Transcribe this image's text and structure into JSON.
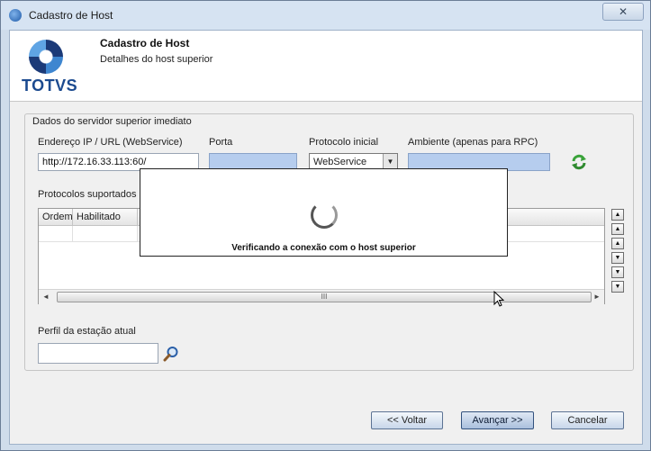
{
  "window": {
    "title": "Cadastro de Host",
    "close_label": "✕"
  },
  "header": {
    "logo_text": "TOTVS",
    "title": "Cadastro de Host",
    "subtitle": "Detalhes do host superior"
  },
  "group": {
    "legend": "Dados do servidor superior imediato",
    "address_label": "Endereço IP / URL (WebService)",
    "address_value": "http://172.16.33.113:60/",
    "port_label": "Porta",
    "port_value": "",
    "protocol_label": "Protocolo inicial",
    "protocol_value": "WebService",
    "environment_label": "Ambiente (apenas para RPC)",
    "environment_value": "",
    "refresh_icon": "refresh-icon"
  },
  "protocols": {
    "label": "Protocolos suportados",
    "columns": [
      "Ordem",
      "Habilitado"
    ],
    "scroll_glyph": "III",
    "scroll_left": "◄",
    "scroll_right": "►"
  },
  "side_buttons": [
    "▲",
    "▲",
    "▲",
    "▼",
    "▼",
    "▼"
  ],
  "profile": {
    "label": "Perfil da estação atual",
    "value": ""
  },
  "buttons": {
    "back": "<< Voltar",
    "next": "Avançar >>",
    "cancel": "Cancelar"
  },
  "overlay": {
    "message": "Verificando a conexão com o host superior"
  },
  "colors": {
    "accent": "#1b4a8f",
    "field_blue": "#b6cdee",
    "refresh_green": "#3aa33a"
  }
}
